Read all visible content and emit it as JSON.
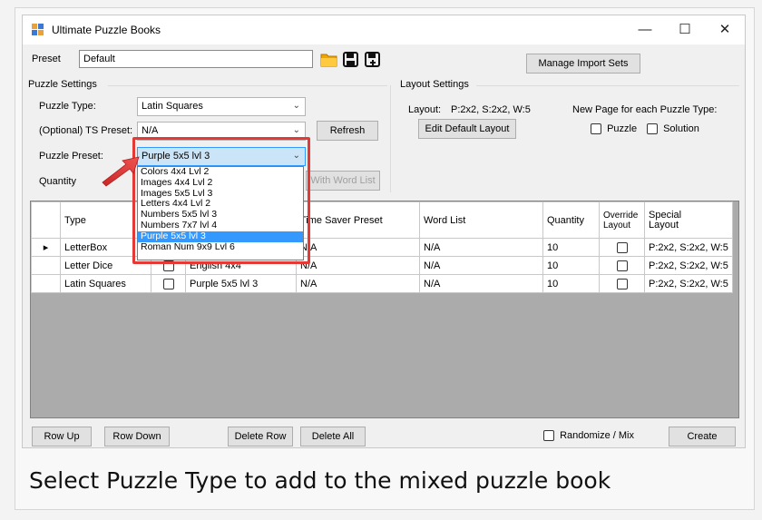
{
  "window": {
    "title": "Ultimate Puzzle Books",
    "controls": {
      "minimize": "—",
      "maximize": "☐",
      "close": "✕"
    }
  },
  "preset": {
    "label": "Preset",
    "value": "Default",
    "manage_import_sets": "Manage Import Sets"
  },
  "puzzle_settings": {
    "group_label": "Puzzle Settings",
    "puzzle_type_label": "Puzzle Type:",
    "puzzle_type_value": "Latin Squares",
    "ts_preset_label": "(Optional) TS Preset:",
    "ts_preset_value": "N/A",
    "refresh": "Refresh",
    "puzzle_preset_label": "Puzzle Preset:",
    "puzzle_preset_value": "Purple 5x5 lvl 3",
    "quantity_label": "Quantity",
    "with_word_list": "With Word List"
  },
  "puzzle_preset_options": [
    "Colors 4x4 Lvl 2",
    "Images 4x4 Lvl 2",
    "Images 5x5 Lvl 3",
    "Letters 4x4 Lvl 2",
    "Numbers 5x5 lvl 3",
    "Numbers 7x7 lvl 4",
    "Purple 5x5 lvl 3",
    "Roman Num 9x9 Lvl 6"
  ],
  "selected_option_index": 6,
  "layout_settings": {
    "group_label": "Layout Settings",
    "layout_label": "Layout:",
    "layout_value": "P:2x2, S:2x2, W:5",
    "edit_default_layout": "Edit Default Layout",
    "new_page_label": "New Page for each Puzzle Type:",
    "puzzle_check": "Puzzle",
    "solution_check": "Solution"
  },
  "grid": {
    "headers": {
      "type": "Type",
      "ts_preset": "Time Saver Preset",
      "word_list": "Word List",
      "quantity": "Quantity",
      "override_1": "Override",
      "override_2": "Layout",
      "special_1": "Special",
      "special_2": "Layout"
    },
    "rows": [
      {
        "type": "LetterBox",
        "preset": "",
        "ts": "N/A",
        "word_list": "N/A",
        "quantity": "10",
        "special": "P:2x2, S:2x2, W:5"
      },
      {
        "type": "Letter Dice",
        "preset": "English 4x4",
        "ts": "N/A",
        "word_list": "N/A",
        "quantity": "10",
        "special": "P:2x2, S:2x2, W:5"
      },
      {
        "type": "Latin Squares",
        "preset": "Purple 5x5 lvl 3",
        "ts": "N/A",
        "word_list": "N/A",
        "quantity": "10",
        "special": "P:2x2, S:2x2, W:5"
      }
    ]
  },
  "bottom_bar": {
    "row_up": "Row Up",
    "row_down": "Row Down",
    "delete_row": "Delete Row",
    "delete_all": "Delete All",
    "randomize": "Randomize / Mix",
    "create": "Create"
  },
  "caption": "Select Puzzle Type to add to the mixed puzzle book",
  "colors": {
    "selection": "#3399ff",
    "highlight": "#e53935",
    "folder": "#f0a500"
  },
  "icons": [
    "app-icon",
    "folder-icon",
    "save-icon",
    "save-as-icon",
    "chevron-down-icon",
    "row-pointer-icon",
    "arrow-pointer-icon"
  ]
}
